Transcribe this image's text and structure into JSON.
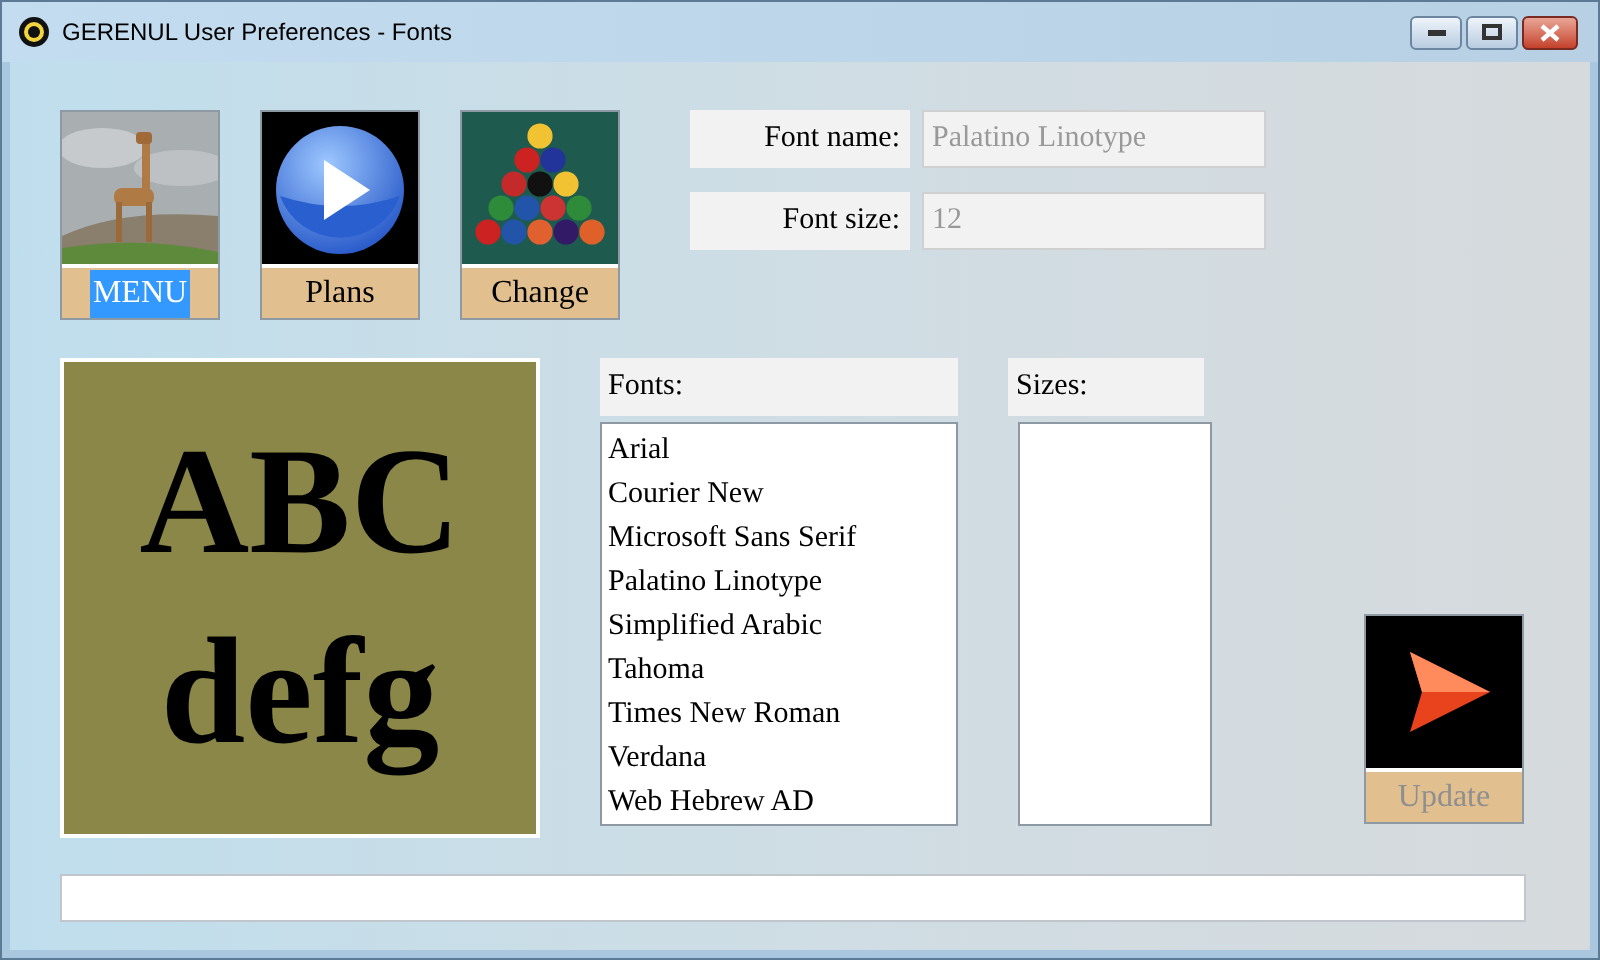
{
  "window": {
    "title": "GERENUL User Preferences - Fonts"
  },
  "tiles": [
    {
      "label": "MENU",
      "selected": true,
      "disabled": false
    },
    {
      "kind": "play",
      "label": "Plans",
      "selected": false,
      "disabled": false
    },
    {
      "kind": "balls",
      "label": "Change",
      "selected": false,
      "disabled": false
    }
  ],
  "fields": [
    {
      "label": "Font name:",
      "value": "Palatino Linotype",
      "disabled": true
    },
    {
      "label": "Font size:",
      "value": "12",
      "disabled": true
    }
  ],
  "preview": {
    "lines": [
      "ABC",
      "defg"
    ]
  },
  "fonts": {
    "label": "Fonts:",
    "items": [
      "Arial",
      "Courier New",
      "Microsoft Sans Serif",
      "Palatino Linotype",
      "Simplified Arabic",
      "Tahoma",
      "Times New Roman",
      "Verdana",
      "Web Hebrew AD"
    ]
  },
  "sizes": {
    "label": "Sizes:"
  },
  "update": {
    "kind": "arrow",
    "label": "Update",
    "selected": false,
    "disabled": true
  }
}
